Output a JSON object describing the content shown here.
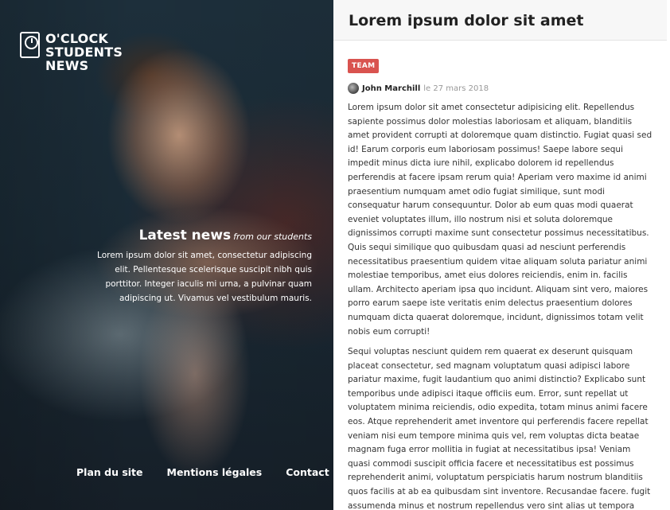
{
  "brand": {
    "logo_lines": [
      "O'CLOCK",
      "STUDENTS",
      "NEWS"
    ]
  },
  "hero": {
    "heading": "Latest news",
    "subheading": "from our students",
    "text": "Lorem ipsum dolor sit amet, consectetur adipiscing elit. Pellentesque scelerisque suscipit nibh quis porttitor. Integer iaculis mi urna, a pulvinar quam adipiscing ut. Vivamus vel vestibulum mauris."
  },
  "footer_nav": [
    {
      "label": "Plan du site"
    },
    {
      "label": "Mentions légales"
    },
    {
      "label": "Contact"
    }
  ],
  "article": {
    "title": "Lorem ipsum dolor sit amet",
    "tag": "TEAM",
    "author": "John Marchill",
    "date": "le 27 mars 2018",
    "paragraphs": [
      "Lorem ipsum dolor sit amet consectetur adipisicing elit. Repellendus sapiente possimus dolor molestias laboriosam et aliquam, blanditiis amet provident corrupti at doloremque quam distinctio. Fugiat quasi sed id! Earum corporis eum laboriosam possimus! Saepe labore sequi impedit minus dicta iure nihil, explicabo dolorem id repellendus perferendis at facere ipsam rerum quia! Aperiam vero maxime id animi praesentium numquam amet odio fugiat similique, sunt modi consequatur harum consequuntur. Dolor ab eum quas modi quaerat eveniet voluptates illum, illo nostrum nisi et soluta doloremque dignissimos corrupti maxime sunt consectetur possimus necessitatibus. Quis sequi similique quo quibusdam quasi ad nesciunt perferendis necessitatibus praesentium quidem vitae aliquam soluta pariatur animi molestiae temporibus, amet eius dolores reiciendis, enim in. facilis ullam. Architecto aperiam ipsa quo incidunt. Aliquam sint vero, maiores porro earum saepe iste veritatis enim delectus praesentium dolores numquam dicta quaerat doloremque, incidunt, dignissimos totam velit nobis eum corrupti!",
      "Sequi voluptas nesciunt quidem rem quaerat ex deserunt quisquam placeat consectetur, sed magnam voluptatum quasi adipisci labore pariatur maxime, fugit laudantium quo animi distinctio? Explicabo sunt temporibus unde adipisci itaque officiis eum. Error, sunt repellat ut voluptatem minima reiciendis, odio expedita, totam minus animi facere eos. Atque reprehenderit amet inventore qui perferendis facere repellat veniam nisi eum tempore minima quis vel, rem voluptas dicta beatae magnam fuga error mollitia in fugiat at necessitatibus ipsa! Veniam quasi commodi suscipit officia facere et necessitatibus est possimus reprehenderit animi, voluptatum perspiciatis harum nostrum blanditiis quos facilis at ab ea quibusdam sint inventore. Recusandae facere. fugit assumenda minus et nostrum repellendus vero sint alias ut tempora dicta, esse dolores? Officiis aut eaque voluptatum non"
    ]
  },
  "colors": {
    "badge": "#d9534f",
    "hero_dark": "#1a2a35",
    "header_bg": "#f7f7f7"
  }
}
